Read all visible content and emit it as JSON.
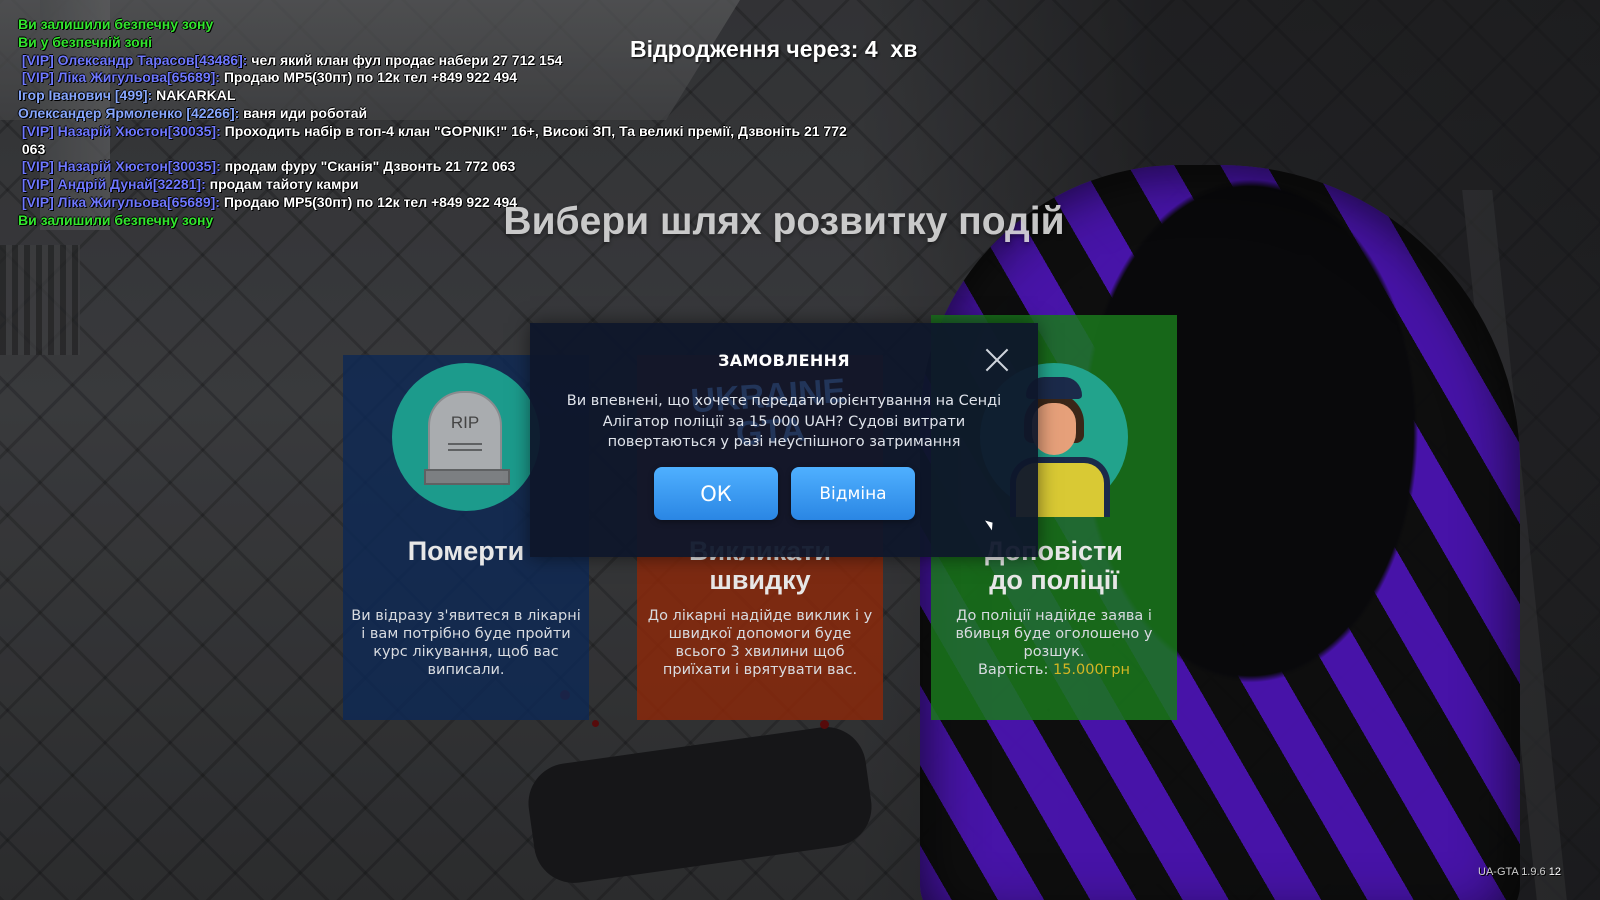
{
  "chat": [
    {
      "parts": [
        {
          "c": "green",
          "t": "Ви залишили безпечну зону"
        }
      ]
    },
    {
      "parts": [
        {
          "c": "green",
          "t": "Ви у безпечній зоні"
        }
      ]
    },
    {
      "parts": [
        {
          "c": "vip",
          "t": " [VIP] Олександр Тарасов[43486]: "
        },
        {
          "c": "white",
          "t": "чел який клан фул продає набери 27 712 154"
        }
      ]
    },
    {
      "parts": [
        {
          "c": "vip",
          "t": " [VIP] Ліка Жигульова[65689]: "
        },
        {
          "c": "white",
          "t": "Продаю MP5(30пт) по 12к тел +849 922 494"
        }
      ]
    },
    {
      "parts": [
        {
          "c": "nick",
          "t": "Ігор Іванович [499]: "
        },
        {
          "c": "white",
          "t": "NAKARKAL"
        }
      ]
    },
    {
      "parts": [
        {
          "c": "nick",
          "t": "Олександер Ярмоленко [42266]: "
        },
        {
          "c": "white",
          "t": "ваня иди роботай"
        }
      ]
    },
    {
      "parts": [
        {
          "c": "vip",
          "t": " [VIP] Назарій Хюстон[30035]: "
        },
        {
          "c": "white",
          "t": "Проходить набір в топ-4 клан \"GOPNIK!\" 16+, Високі ЗП, Та великі премії, Дзвоніть 21 772"
        }
      ]
    },
    {
      "parts": [
        {
          "c": "white",
          "t": " 063"
        }
      ]
    },
    {
      "parts": [
        {
          "c": "vip",
          "t": " [VIP] Назарій Хюстон[30035]: "
        },
        {
          "c": "white",
          "t": "продам фуру \"Сканія\" Дзвонть 21 772 063"
        }
      ]
    },
    {
      "parts": [
        {
          "c": "vip",
          "t": " [VIP] Андрій Дунай[32281]: "
        },
        {
          "c": "white",
          "t": "продам тайоту камри"
        }
      ]
    },
    {
      "parts": [
        {
          "c": "vip",
          "t": " [VIP] Ліка Жигульова[65689]: "
        },
        {
          "c": "white",
          "t": "Продаю MP5(30пт) по 12к тел +849 922 494"
        }
      ]
    },
    {
      "parts": [
        {
          "c": "green",
          "t": "Ви залишили безпечну зону"
        }
      ]
    }
  ],
  "respawn": "Відродження через: 4  хв",
  "choose_title": "Вибери шлях розвитку подій",
  "cards": {
    "die": {
      "icon_text": "RIP",
      "title": "Померти",
      "desc": "Ви відразу з'явитеся в лікарні і вам потрібно буде пройти курс лікування, щоб вас виписали."
    },
    "ambulance": {
      "title_line1": "Викликати",
      "title_line2": "швидку",
      "desc": "До лікарні надійде виклик і у швидкої допомоги буде всього 3 хвилини щоб приїхати і врятувати вас."
    },
    "police": {
      "title_line1": "Доповісти",
      "title_line2": "до поліції",
      "desc": "До поліції надійде заява і вбивця буде оголошено у розшук.",
      "price_label": "Вартість: ",
      "price_value": "15.000грн"
    }
  },
  "modal": {
    "title": "ЗАМОВЛЕННЯ",
    "message": "Ви впевнені, що хочете передати орієнтування на Сенді Алігатор поліції за 15 000 UAH? Судові витрати повертаються у разі неуспішного затримання",
    "ok_label": "ОК",
    "cancel_label": "Відміна",
    "watermark": "UKRAINE GTA"
  },
  "version": {
    "label": "UA-GTA 1.9.6",
    "extra": "12"
  },
  "colors": {
    "green_chat": "#33e62e",
    "vip": "#6f78ff",
    "button": "#2a86e4",
    "price": "#d4b622"
  }
}
